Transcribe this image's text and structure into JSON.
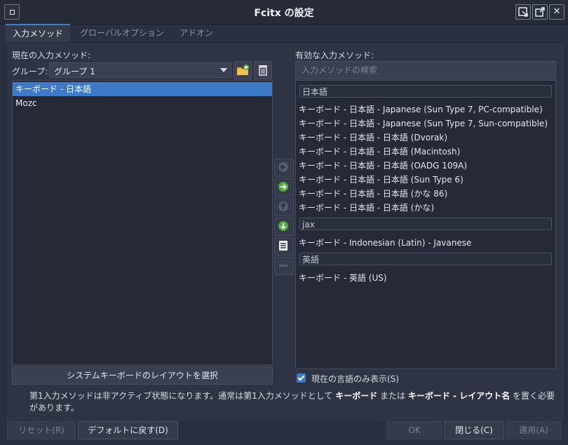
{
  "window": {
    "title": "Fcitx の設定",
    "menu_icon": "window-menu-icon",
    "btn1_icon": "resize-icon",
    "btn2_icon": "external-icon",
    "close_glyph": "✕"
  },
  "tabs": [
    {
      "label": "入力メソッド"
    },
    {
      "label": "グローバルオプション"
    },
    {
      "label": "アドオン"
    }
  ],
  "left": {
    "title": "現在の入力メソッド:",
    "group_label": "グループ:",
    "group_value": "グループ 1",
    "items": [
      {
        "label": "キーボード - 日本語"
      },
      {
        "label": "Mozc"
      }
    ],
    "layout_button": "システムキーボードのレイアウトを選択"
  },
  "right": {
    "title": "有効な入力メソッド:",
    "search_placeholder": "入力メソッドの検索",
    "groups": [
      {
        "header": "日本語",
        "items": [
          "キーボード - 日本語 - Japanese (Sun Type 7, PC-compatible)",
          "キーボード - 日本語 - Japanese (Sun Type 7, Sun-compatible)",
          "キーボード - 日本語 - 日本語 (Dvorak)",
          "キーボード - 日本語 - 日本語 (Macintosh)",
          "キーボード - 日本語 - 日本語 (OADG 109A)",
          "キーボード - 日本語 - 日本語 (Sun Type 6)",
          "キーボード - 日本語 - 日本語 (かな 86)",
          "キーボード - 日本語 - 日本語 (かな)"
        ]
      },
      {
        "header": "jax",
        "items": [
          "キーボード - Indonesian (Latin) - Javanese"
        ]
      },
      {
        "header": "英語",
        "items": [
          "キーボード - 英語 (US)"
        ]
      }
    ],
    "checkbox_label": "現在の言語のみ表示(S)"
  },
  "note": {
    "part1": "第1入力メソッドは非アクティブ状態になります。通常は第1入力メソッドとして ",
    "bold1": "キーボード",
    "part2": " または ",
    "bold2": "キーボード - レイアウト名",
    "part3": " を置く必要があります。"
  },
  "footer": {
    "reset": "リセット(R)",
    "defaults": "デフォルトに戻す(D)",
    "ok": "OK",
    "close": "閉じる(C)",
    "apply": "適用(A)"
  },
  "colors": {
    "accent": "#3d7ac8",
    "green": "#4caf3a"
  }
}
